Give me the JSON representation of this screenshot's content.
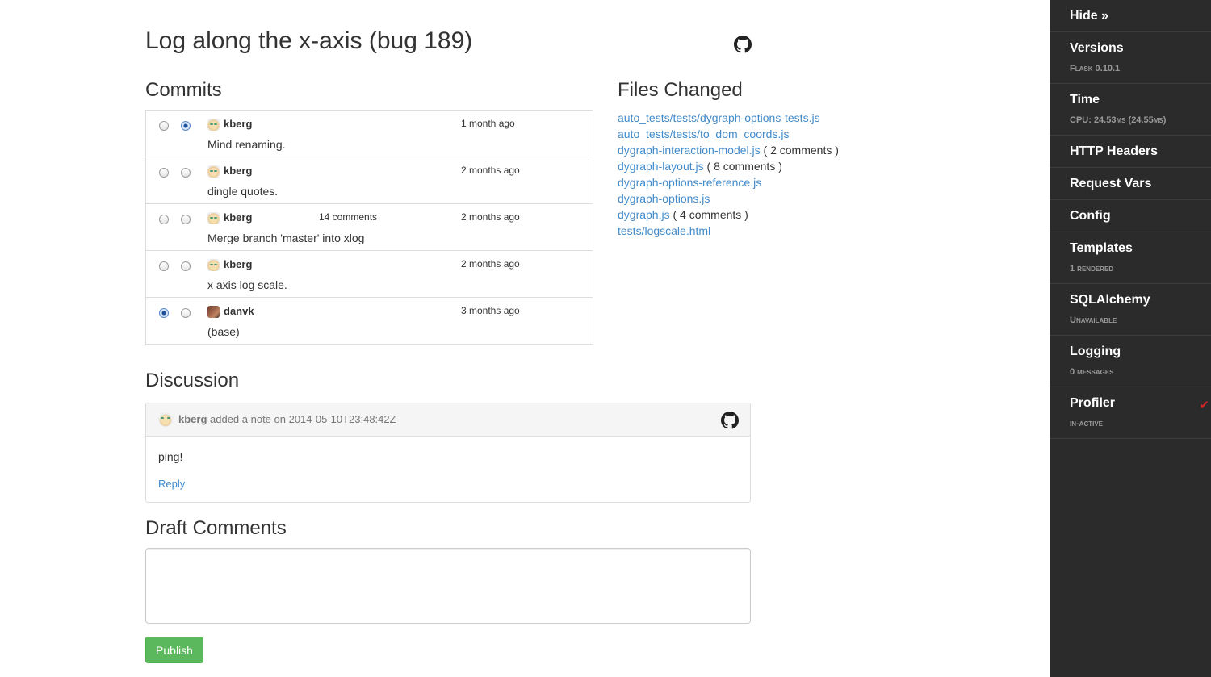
{
  "page": {
    "title": "Log along the x-axis (bug 189)",
    "github_icon": "github-octocat-icon"
  },
  "commits": {
    "heading": "Commits",
    "rows": [
      {
        "author": "kberg",
        "avatar": "kberg-avatar",
        "comments": "",
        "time": "1 month ago",
        "message": "Mind renaming.",
        "left_checked": false,
        "right_checked": true
      },
      {
        "author": "kberg",
        "avatar": "kberg-avatar",
        "comments": "",
        "time": "2 months ago",
        "message": "dingle quotes.",
        "left_checked": false,
        "right_checked": false
      },
      {
        "author": "kberg",
        "avatar": "kberg-avatar",
        "comments": "14 comments",
        "time": "2 months ago",
        "message": "Merge branch 'master' into xlog",
        "left_checked": false,
        "right_checked": false
      },
      {
        "author": "kberg",
        "avatar": "kberg-avatar",
        "comments": "",
        "time": "2 months ago",
        "message": "x axis log scale.",
        "left_checked": false,
        "right_checked": false
      },
      {
        "author": "danvk",
        "avatar": "danvk-avatar",
        "comments": "",
        "time": "3 months ago",
        "message": "(base)",
        "left_checked": true,
        "right_checked": false
      }
    ]
  },
  "files": {
    "heading": "Files Changed",
    "items": [
      {
        "name": "auto_tests/tests/dygraph-options-tests.js",
        "note": ""
      },
      {
        "name": "auto_tests/tests/to_dom_coords.js",
        "note": ""
      },
      {
        "name": "dygraph-interaction-model.js",
        "note": "( 2 comments )"
      },
      {
        "name": "dygraph-layout.js",
        "note": "( 8 comments )"
      },
      {
        "name": "dygraph-options-reference.js",
        "note": ""
      },
      {
        "name": "dygraph-options.js",
        "note": ""
      },
      {
        "name": "dygraph.js",
        "note": "( 4 comments )"
      },
      {
        "name": "tests/logscale.html",
        "note": ""
      }
    ]
  },
  "discussion": {
    "heading": "Discussion",
    "author": "kberg",
    "meta": "added a note on 2014-05-10T23:48:42Z",
    "body": "ping!",
    "reply": "Reply"
  },
  "draft": {
    "heading": "Draft Comments",
    "value": "",
    "publish": "Publish"
  },
  "toolbar": {
    "hide": "Hide »",
    "panels": [
      {
        "title": "Versions",
        "subtitle": "Flask 0.10.1",
        "active": false
      },
      {
        "title": "Time",
        "subtitle": "CPU: 24.53ms (24.55ms)",
        "active": false
      },
      {
        "title": "HTTP Headers",
        "subtitle": "",
        "active": false
      },
      {
        "title": "Request Vars",
        "subtitle": "",
        "active": false
      },
      {
        "title": "Config",
        "subtitle": "",
        "active": false
      },
      {
        "title": "Templates",
        "subtitle": "1 rendered",
        "active": false
      },
      {
        "title": "SQLAlchemy",
        "subtitle": "Unavailable",
        "active": false
      },
      {
        "title": "Logging",
        "subtitle": "0 messages",
        "active": false
      },
      {
        "title": "Profiler",
        "subtitle": "in-active",
        "active": true
      }
    ]
  },
  "colors": {
    "link": "#428bca",
    "publish_button": "#5cb85c",
    "toolbar_bg": "#2b2b2b",
    "profiler_check": "#d02727"
  }
}
